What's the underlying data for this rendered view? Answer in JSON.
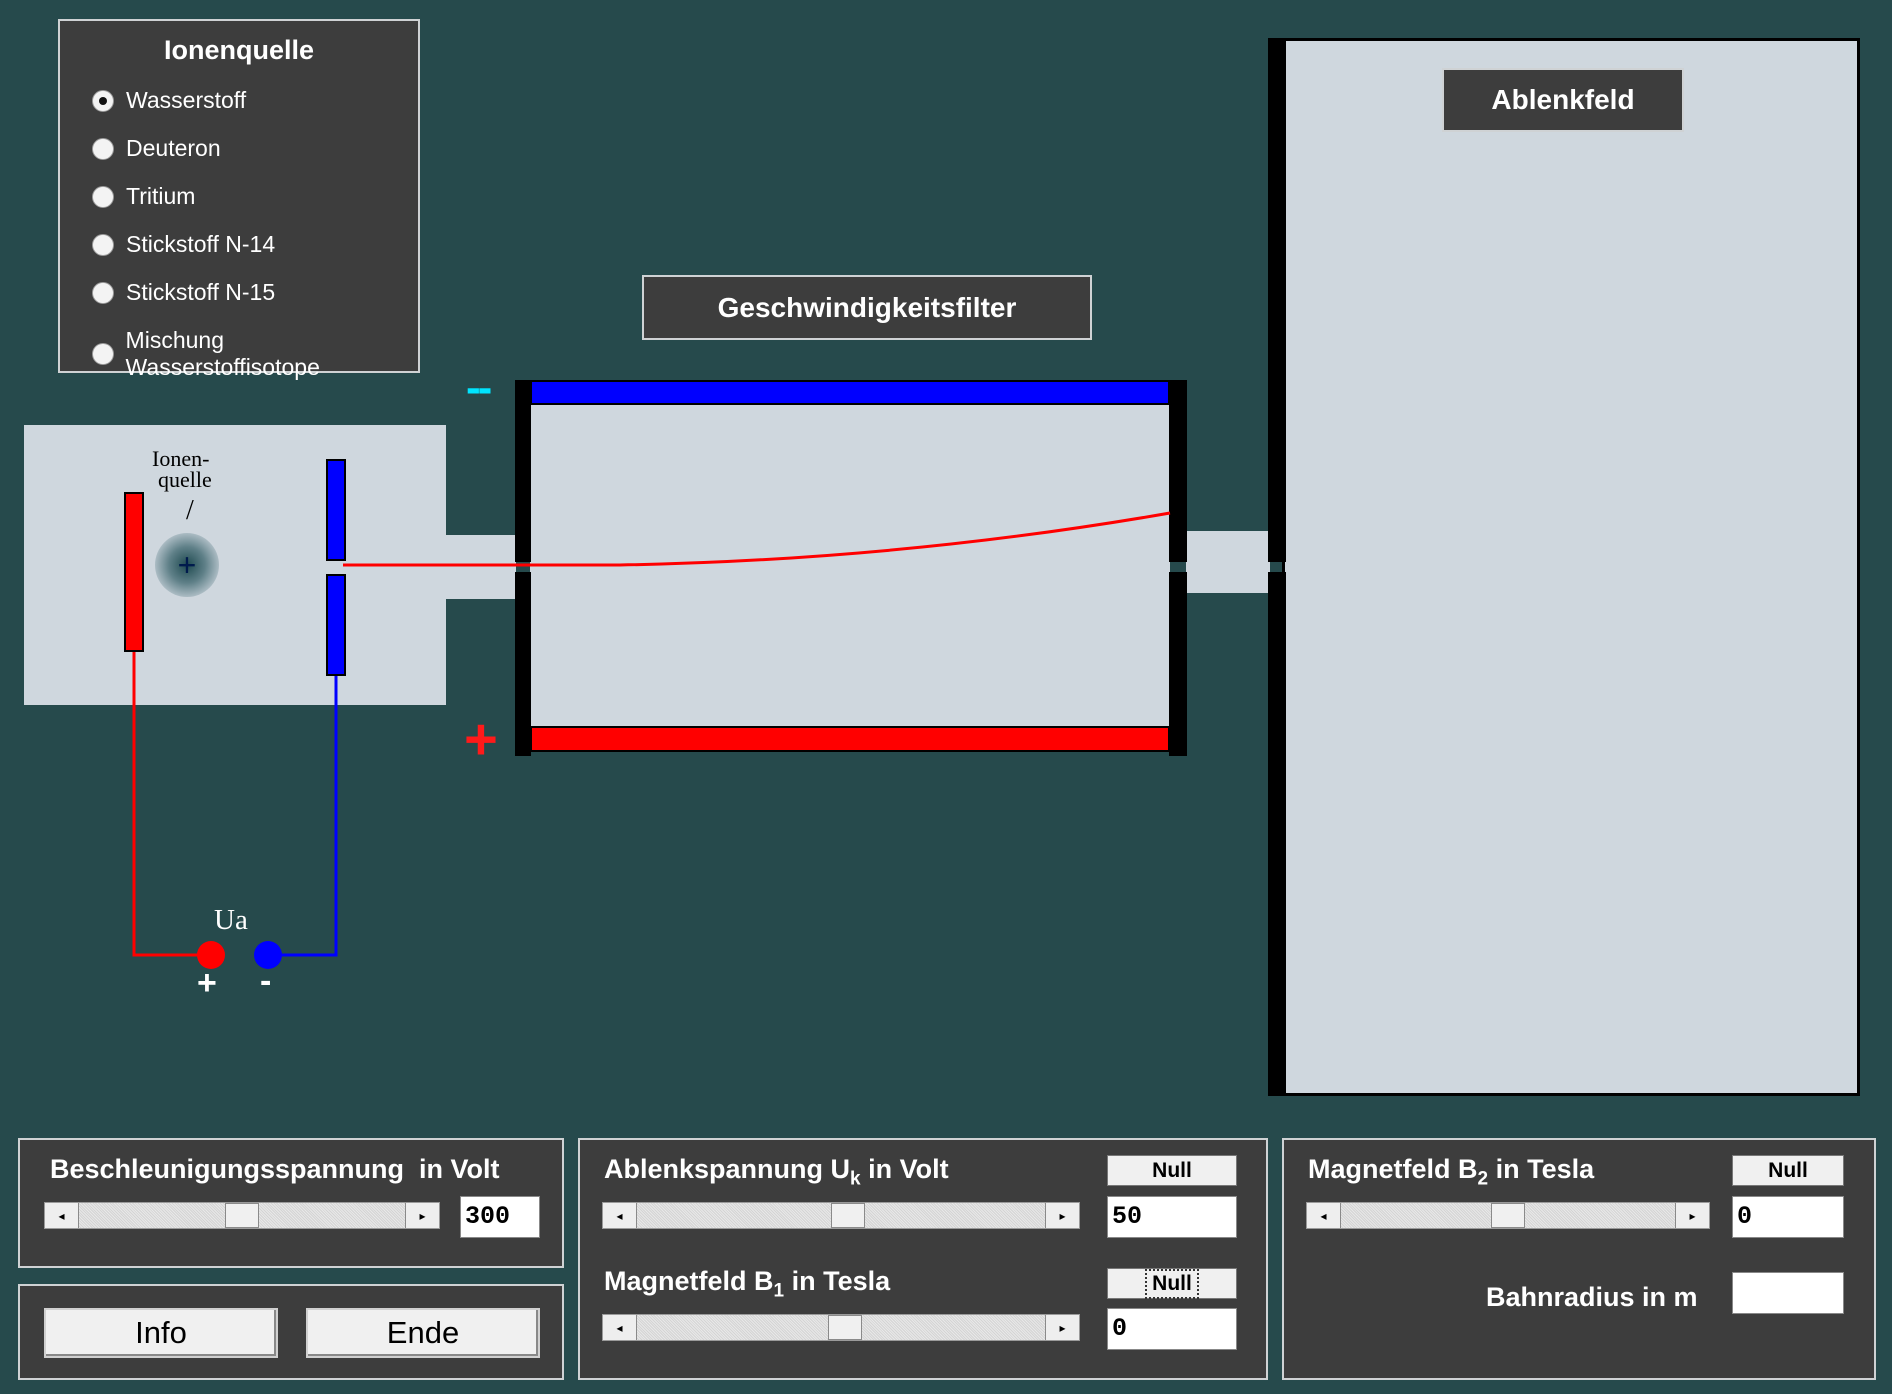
{
  "ion_source_panel": {
    "title": "Ionenquelle",
    "options": [
      {
        "label": "Wasserstoff",
        "checked": true
      },
      {
        "label": "Deuteron",
        "checked": false
      },
      {
        "label": "Tritium",
        "checked": false
      },
      {
        "label": "Stickstoff N-14",
        "checked": false
      },
      {
        "label": "Stickstoff N-15",
        "checked": false
      },
      {
        "label": "Mischung Wasserstoffisotope",
        "checked": false
      }
    ]
  },
  "apparatus": {
    "velocity_filter_title": "Geschwindigkeitsfilter",
    "deflection_field_title": "Ablenkfeld",
    "ion_source_label_line1": "Ionen-",
    "ion_source_label_line2": "quelle",
    "ion_source_slash": "/",
    "ion_symbol": "+",
    "plate_minus_sign": "--",
    "plate_plus_sign": "+",
    "voltage_label": "Ua",
    "terminal_plus": "+",
    "terminal_minus": "-",
    "colors": {
      "positive": "#ff0000",
      "negative": "#0000ff",
      "chamber": "#cfd7de",
      "background": "#264a4c"
    }
  },
  "acceleration_panel": {
    "label": "Beschleunigungsspannung  in Volt",
    "value": "300",
    "slider_fraction": 0.5,
    "left_arrow": "◂",
    "right_arrow": "▸"
  },
  "buttons": {
    "info": "Info",
    "exit": "Ende"
  },
  "filter_panel": {
    "uk_label_pre": "Ablenkspannung U",
    "uk_label_sub": "k",
    "uk_label_post": " in Volt",
    "uk_null": "Null",
    "uk_value": "50",
    "uk_slider_fraction": 0.52,
    "b1_label_pre": "Magnetfeld B",
    "b1_label_sub": "1",
    "b1_label_post": " in Tesla",
    "b1_null": "Null",
    "b1_value": "0",
    "b1_slider_fraction": 0.51,
    "left_arrow": "◂",
    "right_arrow": "▸"
  },
  "deflection_panel": {
    "b2_label_pre": "Magnetfeld B",
    "b2_label_sub": "2",
    "b2_label_post": " in Tesla",
    "b2_null": "Null",
    "b2_value": "0",
    "b2_slider_fraction": 0.5,
    "radius_label": "Bahnradius in m",
    "radius_value": "",
    "left_arrow": "◂",
    "right_arrow": "▸"
  }
}
